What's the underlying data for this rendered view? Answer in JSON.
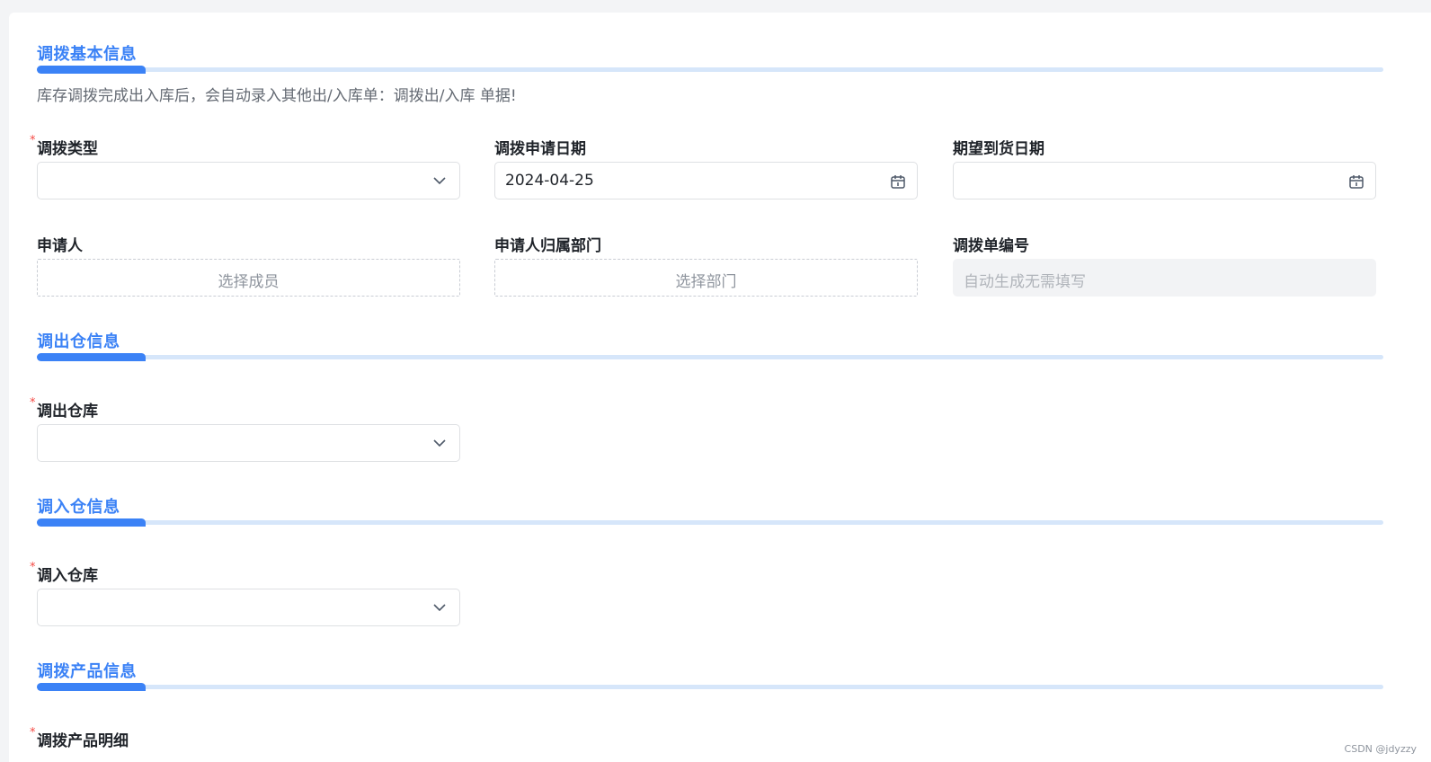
{
  "sections": {
    "basic": {
      "title": "调拨基本信息",
      "hint": "库存调拨完成出入库后，会自动录入其他出/入库单：调拨出/入库 单据!"
    },
    "out": {
      "title": "调出仓信息"
    },
    "in": {
      "title": "调入仓信息"
    },
    "product": {
      "title": "调拨产品信息"
    }
  },
  "fields": {
    "transfer_type": {
      "label": "调拨类型",
      "required_mark": "*",
      "value": ""
    },
    "apply_date": {
      "label": "调拨申请日期",
      "value": "2024-04-25"
    },
    "expected_date": {
      "label": "期望到货日期",
      "value": ""
    },
    "applicant": {
      "label": "申请人",
      "placeholder": "选择成员"
    },
    "applicant_dept": {
      "label": "申请人归属部门",
      "placeholder": "选择部门"
    },
    "order_no": {
      "label": "调拨单编号",
      "placeholder": "自动生成无需填写"
    },
    "out_warehouse": {
      "label": "调出仓库",
      "required_mark": "*",
      "value": ""
    },
    "in_warehouse": {
      "label": "调入仓库",
      "required_mark": "*",
      "value": ""
    },
    "product_detail": {
      "label": "调拨产品明细",
      "required_mark": "*"
    }
  },
  "icons": {
    "select": "chevron-down-icon",
    "date": "calendar-icon"
  },
  "colors": {
    "accent": "#3b82f6",
    "accent_light": "#d6e6fa",
    "required": "#f54a45"
  },
  "watermark": "CSDN @jdyzzy"
}
